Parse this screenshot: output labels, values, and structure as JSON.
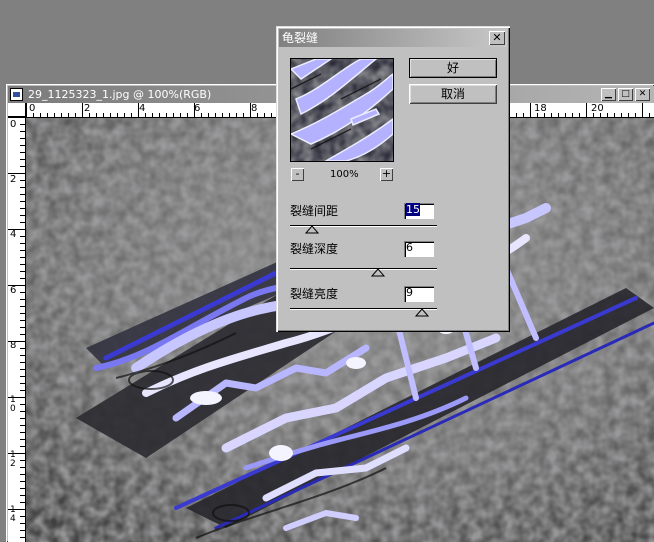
{
  "document": {
    "title": "29_1125323_1.jpg @ 100%(RGB)",
    "ruler_top_labels": [
      "0",
      "2",
      "4",
      "6",
      "8",
      "",
      "",
      "",
      "",
      "",
      "18",
      "20"
    ],
    "ruler_left_labels": [
      "0",
      "2",
      "4",
      "6",
      "8",
      "10",
      "12",
      "14"
    ]
  },
  "dialog": {
    "title": "龟裂缝",
    "ok_label": "好",
    "cancel_label": "取消",
    "zoom_minus": "-",
    "zoom_plus": "+",
    "zoom_level": "100%",
    "params": [
      {
        "label": "裂缝间距",
        "value": "15",
        "slider_fraction": 0.15
      },
      {
        "label": "裂缝深度",
        "value": "6",
        "slider_fraction": 0.6
      },
      {
        "label": "裂缝亮度",
        "value": "9",
        "slider_fraction": 0.9
      }
    ]
  },
  "icons": {
    "minimize": "minimize-icon",
    "maximize": "maximize-icon",
    "close": "close-icon"
  }
}
